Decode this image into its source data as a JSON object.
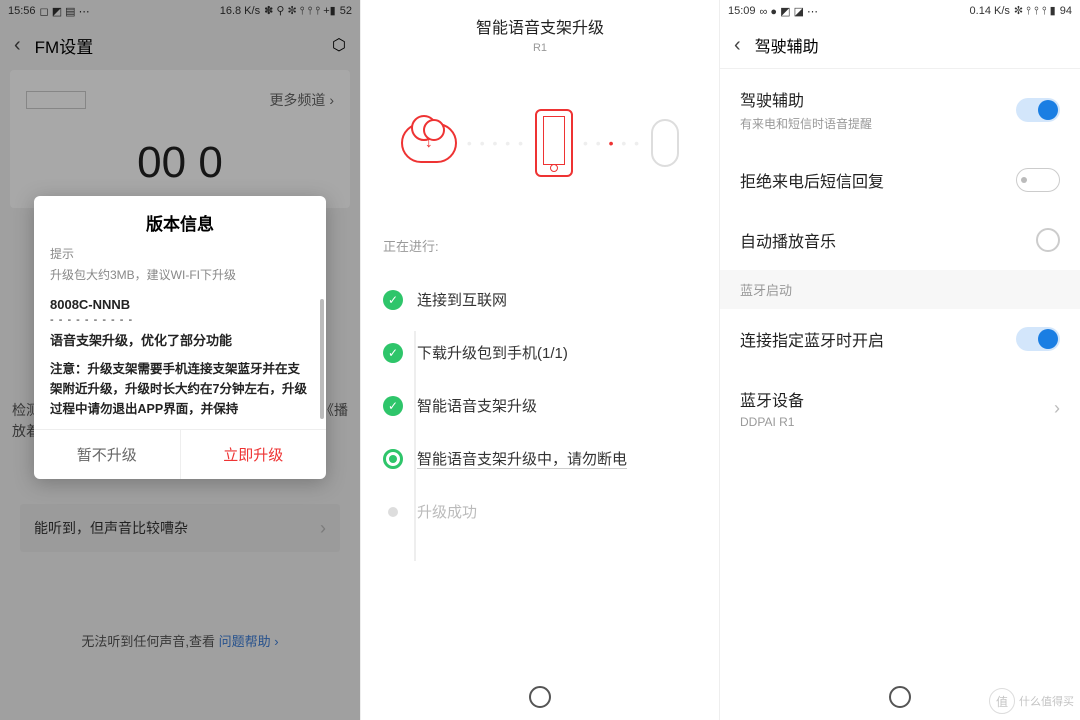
{
  "pane1": {
    "status": {
      "time": "15:56",
      "net": "16.8 K/s",
      "batt": "52"
    },
    "nav": {
      "title": "FM设置"
    },
    "moreChannels": "更多频道",
    "bigFreq": "00 0",
    "sideText1": "检测",
    "sideText2": "放着",
    "sideText3": "《播",
    "hearCard": "能听到，但声音比较嘈杂",
    "noSound": "无法听到任何声音,查看 ",
    "helpLink": "问题帮助",
    "modal": {
      "title": "版本信息",
      "hint": "提示",
      "pkg": "升级包大约3MB，建议WI-FI下升级",
      "vcode": "8008C-NNNB",
      "dashes": "- - - - - - - - - -",
      "desc": "语音支架升级，优化了部分功能",
      "warn": "注意：升级支架需要手机连接支架蓝牙并在支架附近升级，升级时长大约在7分钟左右，升级过程中请勿退出APP界面，并保持",
      "later": "暂不升级",
      "now": "立即升级"
    }
  },
  "pane2": {
    "title": "智能语音支架升级",
    "subtitle": "R1",
    "progressing": "正在进行:",
    "steps": [
      "连接到互联网",
      "下载升级包到手机(1/1)",
      "智能语音支架升级",
      "智能语音支架升级中，请勿断电",
      "升级成功"
    ]
  },
  "pane3": {
    "status": {
      "time": "15:09",
      "net": "0.14 K/s",
      "batt": "94"
    },
    "nav": {
      "title": "驾驶辅助"
    },
    "rows": {
      "assist": {
        "label": "驾驶辅助",
        "sub": "有来电和短信时语音提醒"
      },
      "reject": {
        "label": "拒绝来电后短信回复"
      },
      "autoplay": {
        "label": "自动播放音乐"
      },
      "btHeader": "蓝牙启动",
      "btConn": {
        "label": "连接指定蓝牙时开启"
      },
      "btDev": {
        "label": "蓝牙设备",
        "sub": "DDPAI R1"
      }
    }
  },
  "watermark": {
    "badge": "值",
    "text": "什么值得买"
  }
}
